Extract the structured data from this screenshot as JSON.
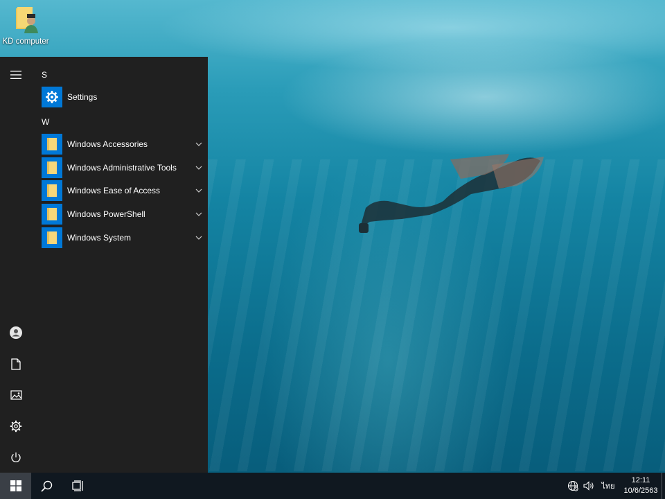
{
  "desktop": {
    "icons": [
      {
        "label": "KD computer",
        "icon": "user-folder-icon"
      }
    ]
  },
  "start_menu": {
    "rail": [
      {
        "icon": "hamburger-menu-icon"
      },
      {
        "icon": "user-account-icon"
      },
      {
        "icon": "documents-icon"
      },
      {
        "icon": "pictures-icon"
      },
      {
        "icon": "settings-gear-icon"
      },
      {
        "icon": "power-icon"
      }
    ],
    "groups": [
      {
        "letter": "S",
        "items": [
          {
            "label": "Settings",
            "icon": "gear-icon",
            "expandable": false
          }
        ]
      },
      {
        "letter": "W",
        "items": [
          {
            "label": "Windows Accessories",
            "icon": "folder-icon",
            "expandable": true
          },
          {
            "label": "Windows Administrative Tools",
            "icon": "folder-icon",
            "expandable": true
          },
          {
            "label": "Windows Ease of Access",
            "icon": "folder-icon",
            "expandable": true
          },
          {
            "label": "Windows PowerShell",
            "icon": "folder-icon",
            "expandable": true
          },
          {
            "label": "Windows System",
            "icon": "folder-icon",
            "expandable": true
          }
        ]
      }
    ],
    "tile_color": "#0078d7",
    "background_color": "#202020"
  },
  "taskbar": {
    "buttons": [
      {
        "icon": "windows-start-icon"
      },
      {
        "icon": "search-icon"
      },
      {
        "icon": "task-view-icon"
      }
    ],
    "tray": [
      {
        "icon": "network-globe-icon"
      },
      {
        "icon": "volume-icon"
      }
    ],
    "language": "ไทย",
    "clock": {
      "time": "12:11",
      "date": "10/6/2563"
    },
    "background_color": "#101820"
  }
}
